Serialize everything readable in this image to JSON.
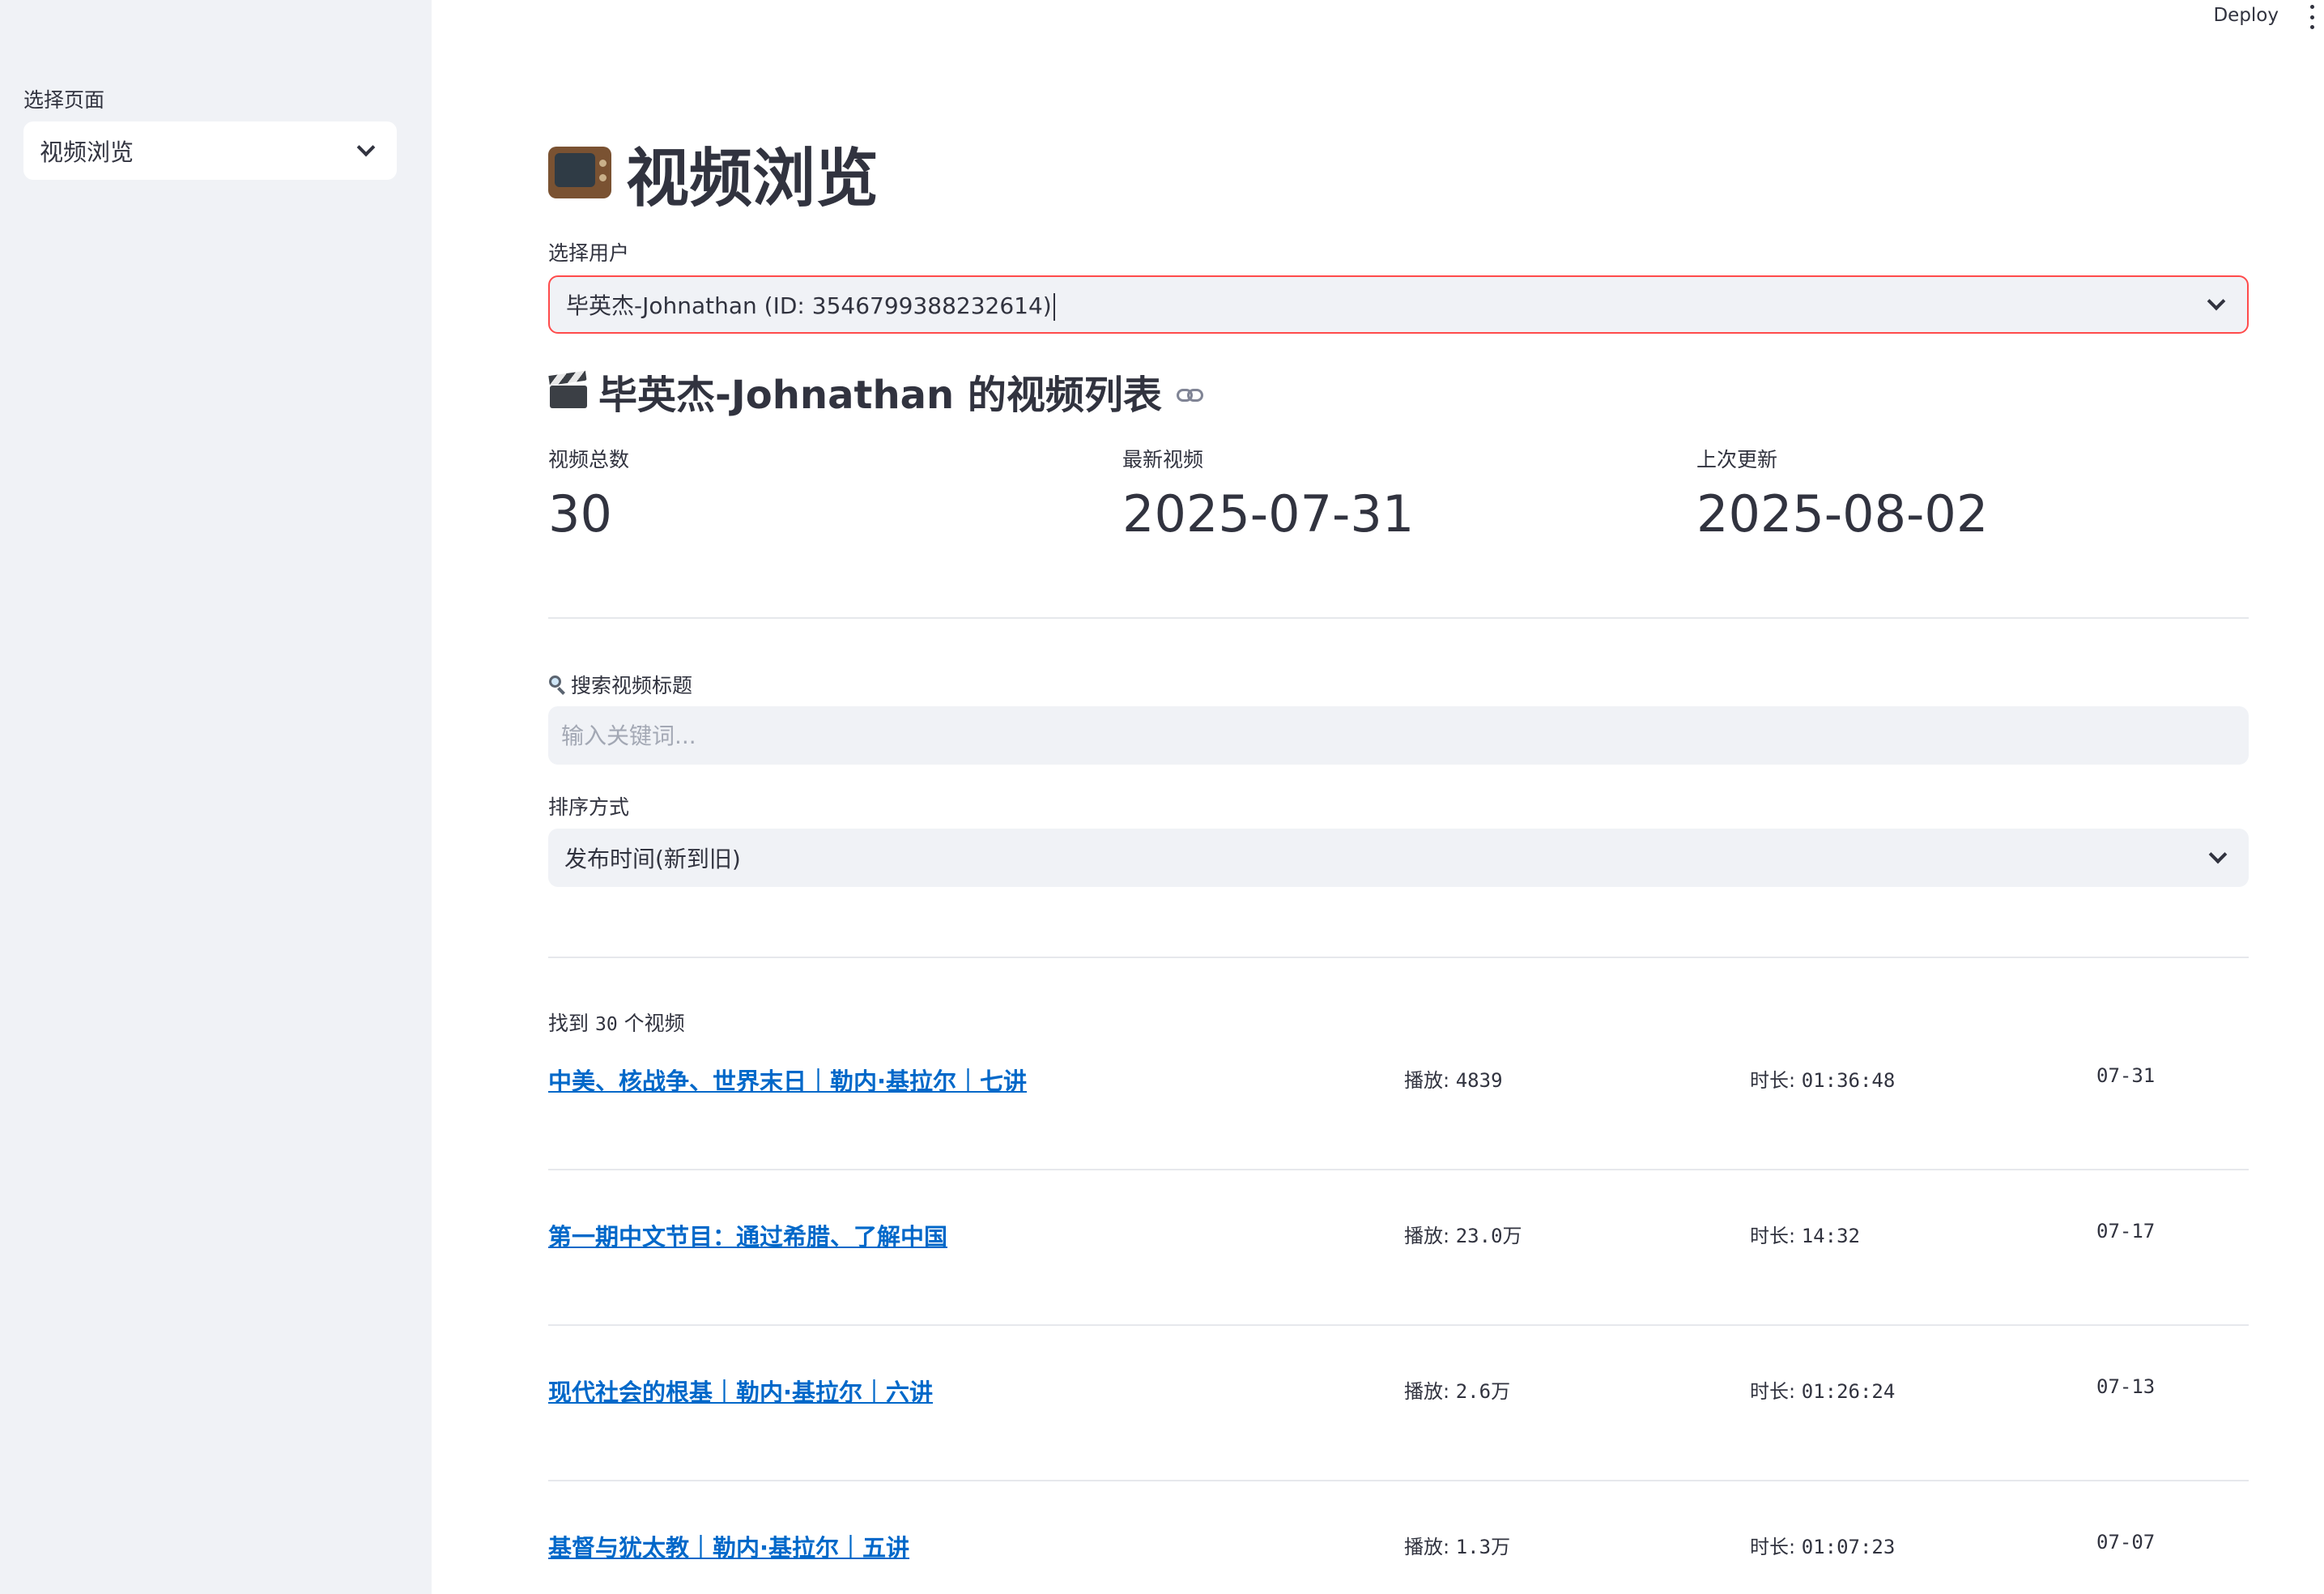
{
  "header": {
    "deploy_label": "Deploy",
    "menu_icon": "kebab-menu-icon"
  },
  "sidebar": {
    "label": "选择页面",
    "selected": "视频浏览"
  },
  "main": {
    "title": "视频浏览",
    "title_icon": "television-icon",
    "user_select": {
      "label": "选择用户",
      "value": "毕英杰-Johnathan (ID: 3546799388232614)"
    },
    "section_title": "毕英杰-Johnathan 的视频列表",
    "section_icon": "clapper-board-icon",
    "metrics": [
      {
        "label": "视频总数",
        "value": "30"
      },
      {
        "label": "最新视频",
        "value": "2025-07-31"
      },
      {
        "label": "上次更新",
        "value": "2025-08-02"
      }
    ],
    "search": {
      "label": "搜索视频标题",
      "placeholder": "输入关键词..."
    },
    "sort": {
      "label": "排序方式",
      "value": "发布时间(新到旧)"
    },
    "found": {
      "prefix": "找到",
      "count": "30",
      "suffix": "个视频"
    },
    "videos": [
      {
        "title": "中美、核战争、世界末日｜勒内·基拉尔｜七讲",
        "views_label": "播放:",
        "views": "4839",
        "duration_label": "时长:",
        "duration": "01:36:48",
        "date": "07-31"
      },
      {
        "title": "第一期中文节目：通过希腊、了解中国",
        "views_label": "播放:",
        "views": "23.0万",
        "duration_label": "时长:",
        "duration": "14:32",
        "date": "07-17"
      },
      {
        "title": "现代社会的根基｜勒内·基拉尔｜六讲",
        "views_label": "播放:",
        "views": "2.6万",
        "duration_label": "时长:",
        "duration": "01:26:24",
        "date": "07-13"
      },
      {
        "title": "基督与犹太教｜勒内·基拉尔｜五讲",
        "views_label": "播放:",
        "views": "1.3万",
        "duration_label": "时长:",
        "duration": "01:07:23",
        "date": "07-07"
      }
    ]
  }
}
